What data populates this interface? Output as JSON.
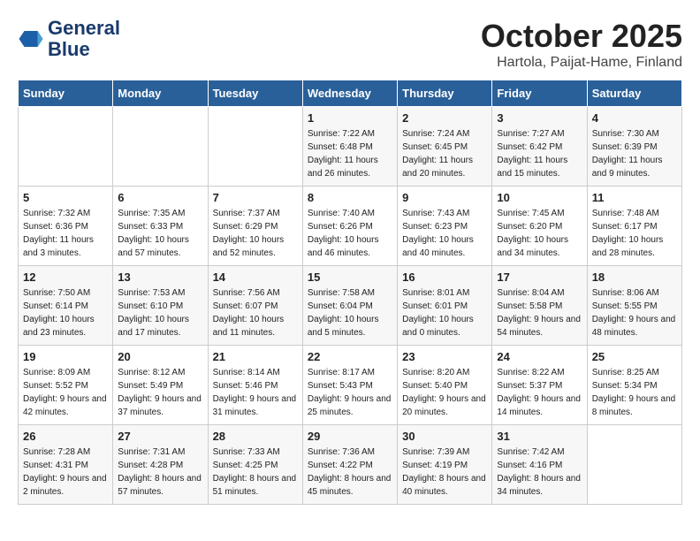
{
  "header": {
    "logo_line1": "General",
    "logo_line2": "Blue",
    "month": "October 2025",
    "location": "Hartola, Paijat-Hame, Finland"
  },
  "weekdays": [
    "Sunday",
    "Monday",
    "Tuesday",
    "Wednesday",
    "Thursday",
    "Friday",
    "Saturday"
  ],
  "weeks": [
    [
      {
        "day": "",
        "sunrise": "",
        "sunset": "",
        "daylight": ""
      },
      {
        "day": "",
        "sunrise": "",
        "sunset": "",
        "daylight": ""
      },
      {
        "day": "",
        "sunrise": "",
        "sunset": "",
        "daylight": ""
      },
      {
        "day": "1",
        "sunrise": "Sunrise: 7:22 AM",
        "sunset": "Sunset: 6:48 PM",
        "daylight": "Daylight: 11 hours and 26 minutes."
      },
      {
        "day": "2",
        "sunrise": "Sunrise: 7:24 AM",
        "sunset": "Sunset: 6:45 PM",
        "daylight": "Daylight: 11 hours and 20 minutes."
      },
      {
        "day": "3",
        "sunrise": "Sunrise: 7:27 AM",
        "sunset": "Sunset: 6:42 PM",
        "daylight": "Daylight: 11 hours and 15 minutes."
      },
      {
        "day": "4",
        "sunrise": "Sunrise: 7:30 AM",
        "sunset": "Sunset: 6:39 PM",
        "daylight": "Daylight: 11 hours and 9 minutes."
      }
    ],
    [
      {
        "day": "5",
        "sunrise": "Sunrise: 7:32 AM",
        "sunset": "Sunset: 6:36 PM",
        "daylight": "Daylight: 11 hours and 3 minutes."
      },
      {
        "day": "6",
        "sunrise": "Sunrise: 7:35 AM",
        "sunset": "Sunset: 6:33 PM",
        "daylight": "Daylight: 10 hours and 57 minutes."
      },
      {
        "day": "7",
        "sunrise": "Sunrise: 7:37 AM",
        "sunset": "Sunset: 6:29 PM",
        "daylight": "Daylight: 10 hours and 52 minutes."
      },
      {
        "day": "8",
        "sunrise": "Sunrise: 7:40 AM",
        "sunset": "Sunset: 6:26 PM",
        "daylight": "Daylight: 10 hours and 46 minutes."
      },
      {
        "day": "9",
        "sunrise": "Sunrise: 7:43 AM",
        "sunset": "Sunset: 6:23 PM",
        "daylight": "Daylight: 10 hours and 40 minutes."
      },
      {
        "day": "10",
        "sunrise": "Sunrise: 7:45 AM",
        "sunset": "Sunset: 6:20 PM",
        "daylight": "Daylight: 10 hours and 34 minutes."
      },
      {
        "day": "11",
        "sunrise": "Sunrise: 7:48 AM",
        "sunset": "Sunset: 6:17 PM",
        "daylight": "Daylight: 10 hours and 28 minutes."
      }
    ],
    [
      {
        "day": "12",
        "sunrise": "Sunrise: 7:50 AM",
        "sunset": "Sunset: 6:14 PM",
        "daylight": "Daylight: 10 hours and 23 minutes."
      },
      {
        "day": "13",
        "sunrise": "Sunrise: 7:53 AM",
        "sunset": "Sunset: 6:10 PM",
        "daylight": "Daylight: 10 hours and 17 minutes."
      },
      {
        "day": "14",
        "sunrise": "Sunrise: 7:56 AM",
        "sunset": "Sunset: 6:07 PM",
        "daylight": "Daylight: 10 hours and 11 minutes."
      },
      {
        "day": "15",
        "sunrise": "Sunrise: 7:58 AM",
        "sunset": "Sunset: 6:04 PM",
        "daylight": "Daylight: 10 hours and 5 minutes."
      },
      {
        "day": "16",
        "sunrise": "Sunrise: 8:01 AM",
        "sunset": "Sunset: 6:01 PM",
        "daylight": "Daylight: 10 hours and 0 minutes."
      },
      {
        "day": "17",
        "sunrise": "Sunrise: 8:04 AM",
        "sunset": "Sunset: 5:58 PM",
        "daylight": "Daylight: 9 hours and 54 minutes."
      },
      {
        "day": "18",
        "sunrise": "Sunrise: 8:06 AM",
        "sunset": "Sunset: 5:55 PM",
        "daylight": "Daylight: 9 hours and 48 minutes."
      }
    ],
    [
      {
        "day": "19",
        "sunrise": "Sunrise: 8:09 AM",
        "sunset": "Sunset: 5:52 PM",
        "daylight": "Daylight: 9 hours and 42 minutes."
      },
      {
        "day": "20",
        "sunrise": "Sunrise: 8:12 AM",
        "sunset": "Sunset: 5:49 PM",
        "daylight": "Daylight: 9 hours and 37 minutes."
      },
      {
        "day": "21",
        "sunrise": "Sunrise: 8:14 AM",
        "sunset": "Sunset: 5:46 PM",
        "daylight": "Daylight: 9 hours and 31 minutes."
      },
      {
        "day": "22",
        "sunrise": "Sunrise: 8:17 AM",
        "sunset": "Sunset: 5:43 PM",
        "daylight": "Daylight: 9 hours and 25 minutes."
      },
      {
        "day": "23",
        "sunrise": "Sunrise: 8:20 AM",
        "sunset": "Sunset: 5:40 PM",
        "daylight": "Daylight: 9 hours and 20 minutes."
      },
      {
        "day": "24",
        "sunrise": "Sunrise: 8:22 AM",
        "sunset": "Sunset: 5:37 PM",
        "daylight": "Daylight: 9 hours and 14 minutes."
      },
      {
        "day": "25",
        "sunrise": "Sunrise: 8:25 AM",
        "sunset": "Sunset: 5:34 PM",
        "daylight": "Daylight: 9 hours and 8 minutes."
      }
    ],
    [
      {
        "day": "26",
        "sunrise": "Sunrise: 7:28 AM",
        "sunset": "Sunset: 4:31 PM",
        "daylight": "Daylight: 9 hours and 2 minutes."
      },
      {
        "day": "27",
        "sunrise": "Sunrise: 7:31 AM",
        "sunset": "Sunset: 4:28 PM",
        "daylight": "Daylight: 8 hours and 57 minutes."
      },
      {
        "day": "28",
        "sunrise": "Sunrise: 7:33 AM",
        "sunset": "Sunset: 4:25 PM",
        "daylight": "Daylight: 8 hours and 51 minutes."
      },
      {
        "day": "29",
        "sunrise": "Sunrise: 7:36 AM",
        "sunset": "Sunset: 4:22 PM",
        "daylight": "Daylight: 8 hours and 45 minutes."
      },
      {
        "day": "30",
        "sunrise": "Sunrise: 7:39 AM",
        "sunset": "Sunset: 4:19 PM",
        "daylight": "Daylight: 8 hours and 40 minutes."
      },
      {
        "day": "31",
        "sunrise": "Sunrise: 7:42 AM",
        "sunset": "Sunset: 4:16 PM",
        "daylight": "Daylight: 8 hours and 34 minutes."
      },
      {
        "day": "",
        "sunrise": "",
        "sunset": "",
        "daylight": ""
      }
    ]
  ]
}
